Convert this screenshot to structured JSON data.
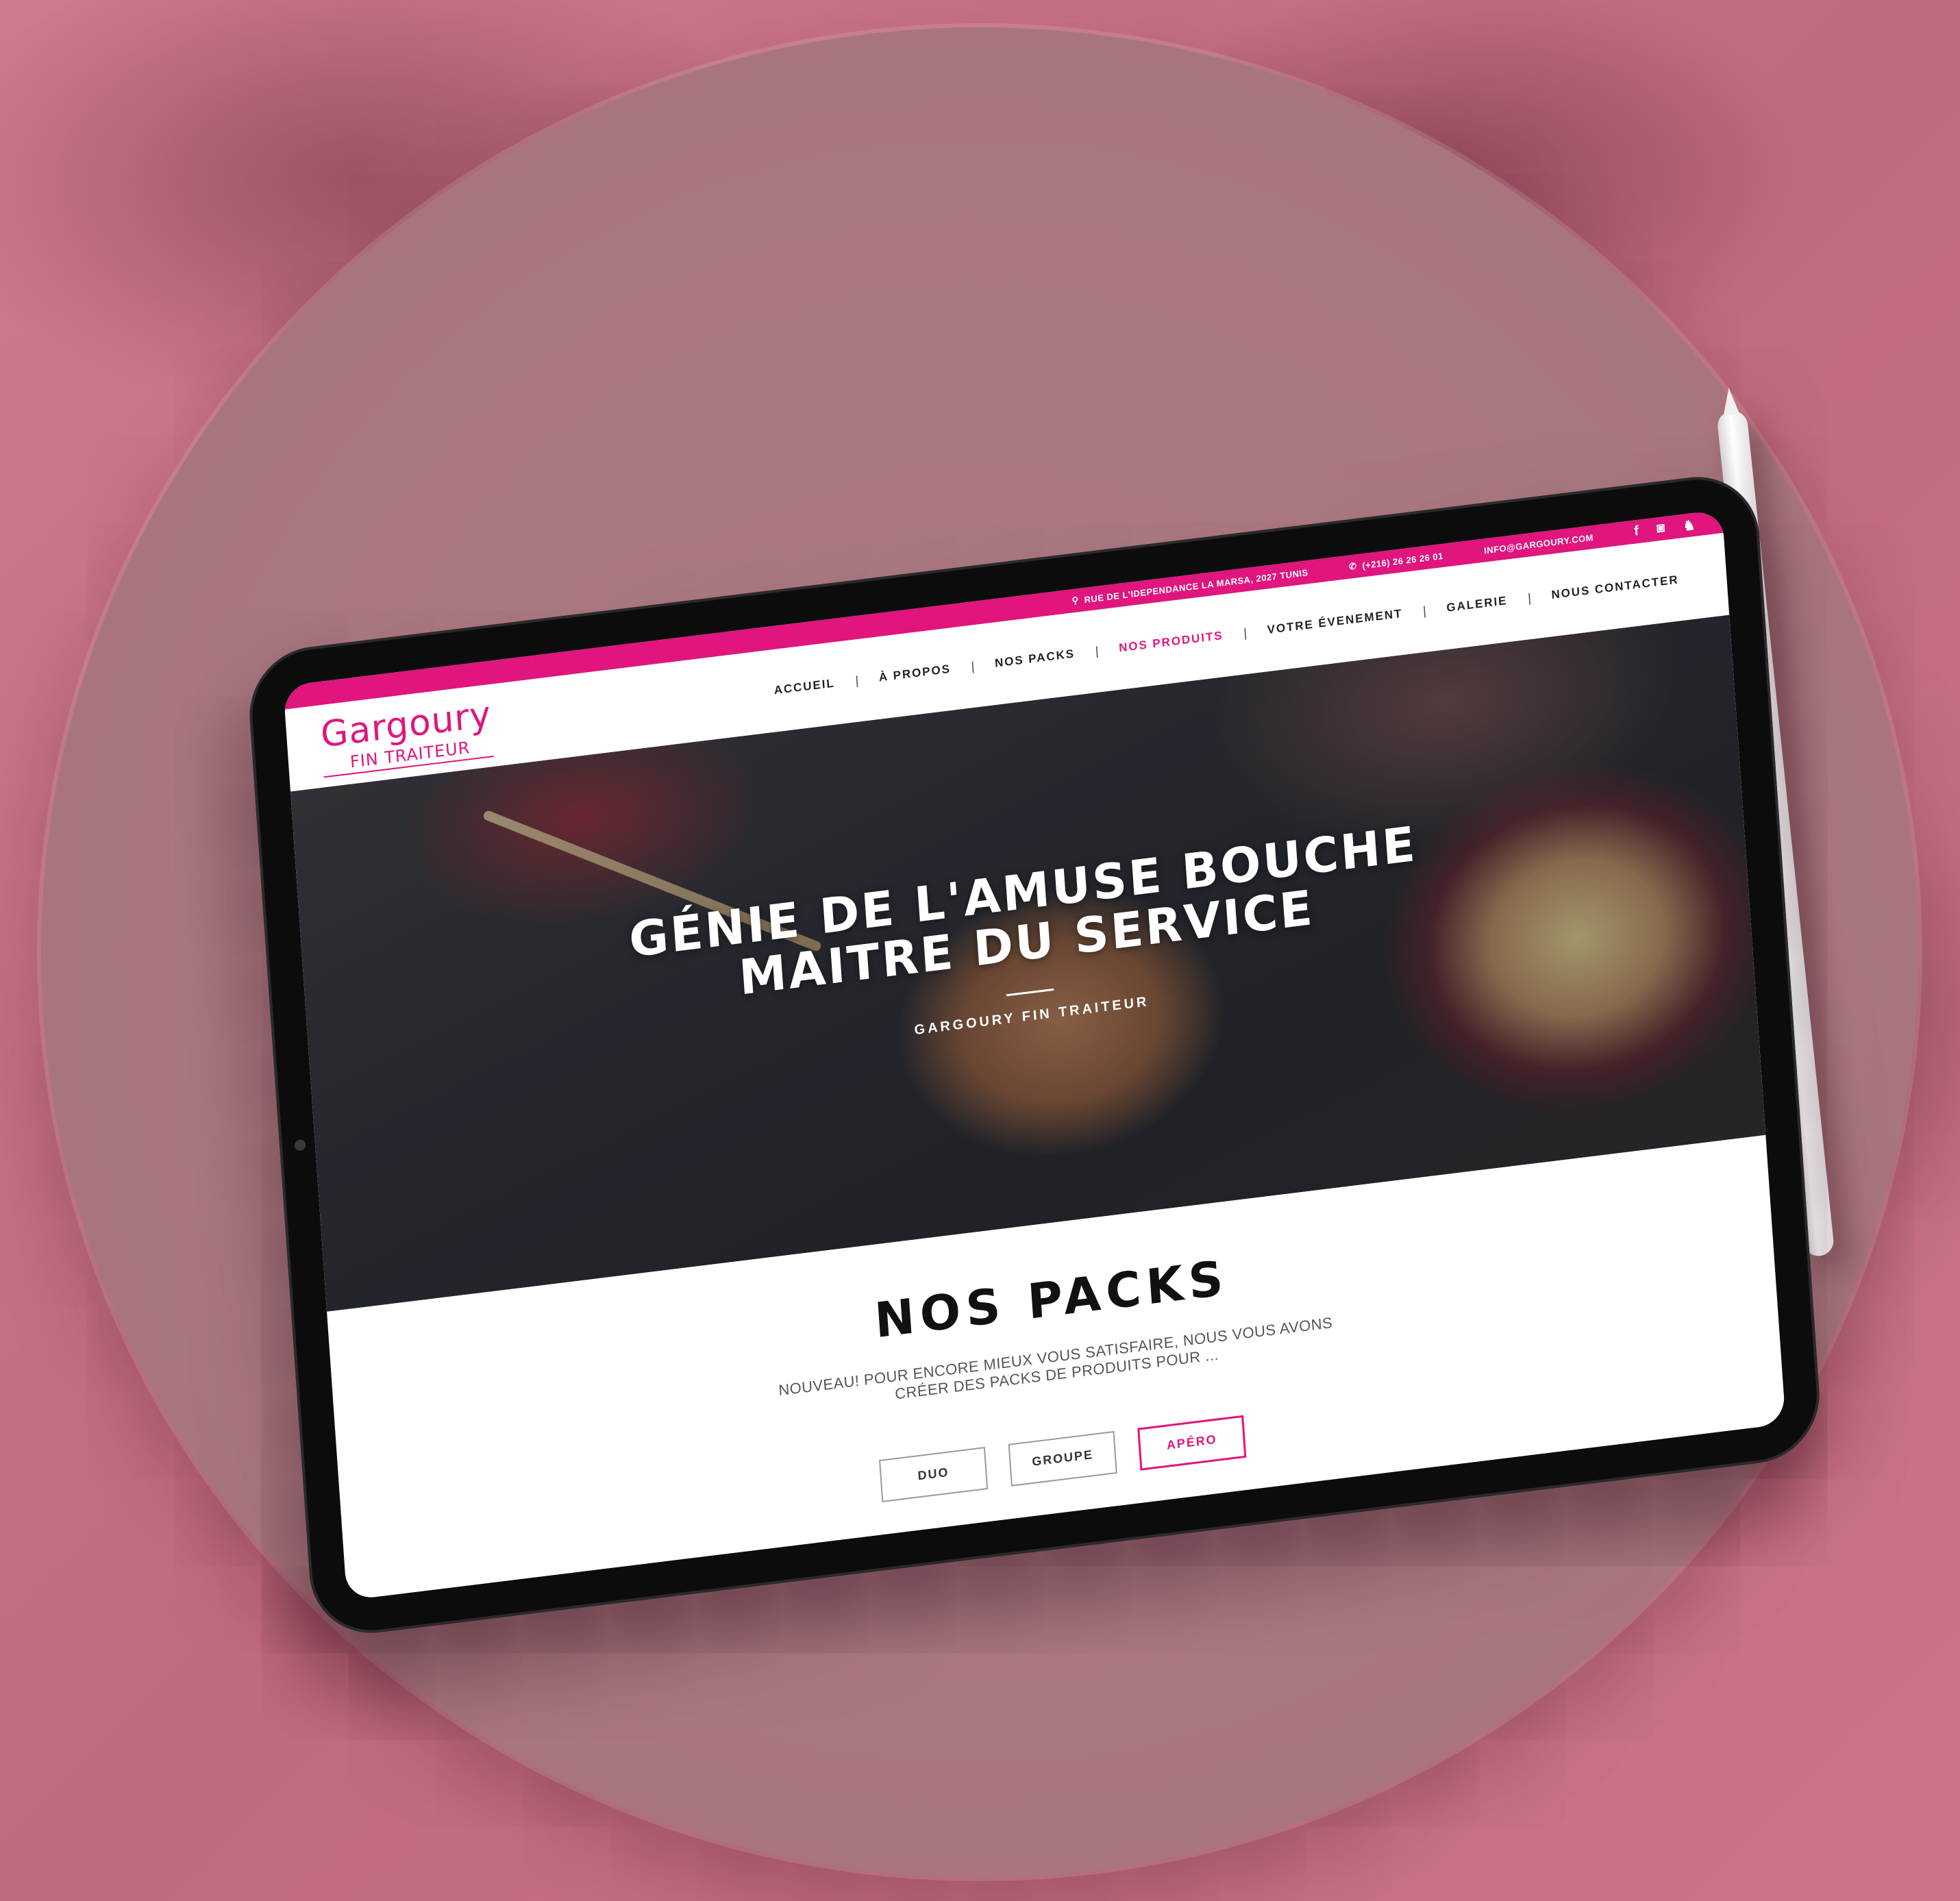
{
  "topbar": {
    "address": "RUE DE L'IDEPENDANCE LA MARSA, 2027 TUNIS",
    "phone": "(+216) 26 26 26 01",
    "email": "INFO@GARGOURY.COM",
    "social": [
      "facebook-icon",
      "instagram-icon",
      "snapchat-icon"
    ]
  },
  "logo": {
    "main": "Gargoury",
    "sub": "FIN TRAITEUR"
  },
  "nav": {
    "items": [
      "ACCUEIL",
      "À PROPOS",
      "NOS PACKS",
      "NOS PRODUITS",
      "VOTRE ÉVENEMENT",
      "GALERIE",
      "NOUS CONTACTER"
    ],
    "active": "NOS PRODUITS"
  },
  "hero": {
    "line1": "GÉNIE DE L'AMUSE BOUCHE",
    "line2": "MAITRE DU SERVICE",
    "subtitle": "GARGOURY FIN TRAITEUR"
  },
  "packs": {
    "title": "NOS PACKS",
    "lead": "NOUVEAU! POUR ENCORE MIEUX VOUS SATISFAIRE, NOUS VOUS AVONS CRÉER DES PACKS DE PRODUITS POUR ...",
    "tabs": [
      "DUO",
      "GROUPE",
      "APÉRO"
    ],
    "active_tab": "APÉRO"
  },
  "colors": {
    "brand": "#e0157d",
    "background": "#c46d80"
  }
}
